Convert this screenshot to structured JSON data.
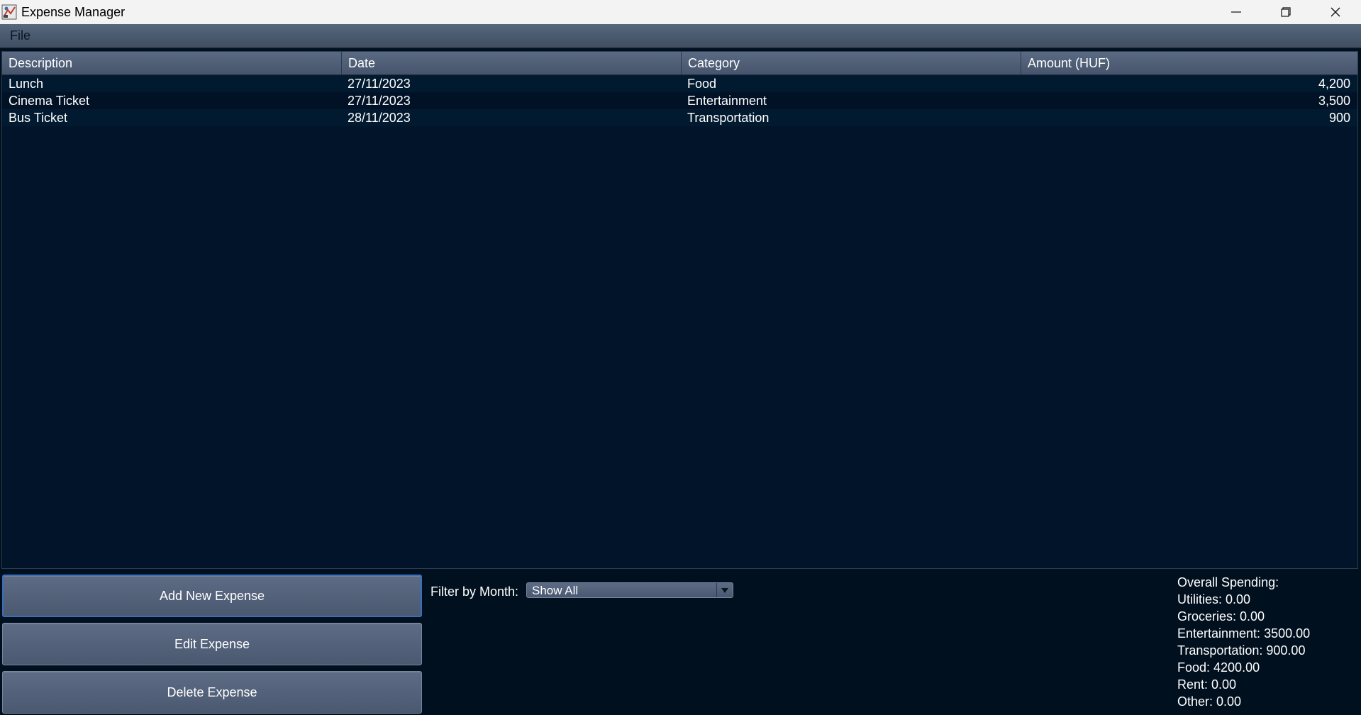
{
  "window": {
    "title": "Expense Manager",
    "icon": "app-icon",
    "controls": [
      "minimize-icon",
      "maximize-icon",
      "close-icon"
    ]
  },
  "menu": {
    "items": [
      {
        "label": "File"
      }
    ]
  },
  "table": {
    "columns": [
      "Description",
      "Date",
      "Category",
      "Amount (HUF)"
    ],
    "rows": [
      {
        "description": "Lunch",
        "date": "27/11/2023",
        "category": "Food",
        "amount": "4,200"
      },
      {
        "description": "Cinema Ticket",
        "date": "27/11/2023",
        "category": "Entertainment",
        "amount": "3,500"
      },
      {
        "description": "Bus Ticket",
        "date": "28/11/2023",
        "category": "Transportation",
        "amount": "900"
      }
    ]
  },
  "actions": {
    "add_label": "Add New Expense",
    "edit_label": "Edit Expense",
    "delete_label": "Delete Expense"
  },
  "filter": {
    "label": "Filter by Month:",
    "selected": "Show All"
  },
  "summary": {
    "lines": [
      "Overall Spending:",
      "Utilities: 0.00",
      "Groceries: 0.00",
      "Entertainment: 3500.00",
      "Transportation: 900.00",
      "Food: 4200.00",
      "Rent: 0.00",
      "Other: 0.00"
    ]
  },
  "colors": {
    "background": "#01101f",
    "table_background": "#01142a",
    "header_gradient_top": "#5a6a82",
    "button_gradient_top": "#5d6c85",
    "focus_border": "#3b6fb8",
    "text": "#ffffff"
  }
}
